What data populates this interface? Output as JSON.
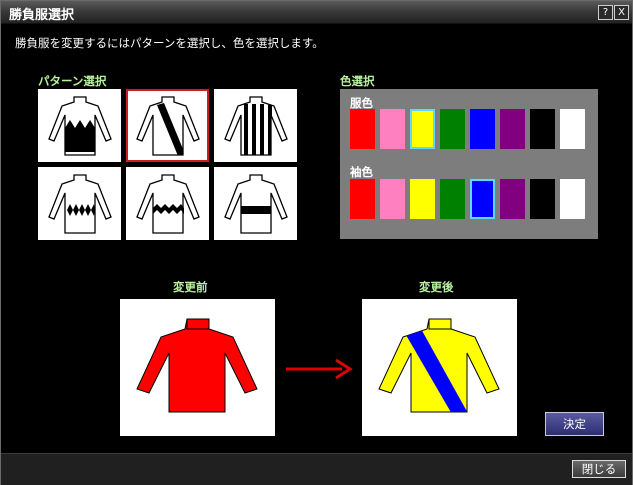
{
  "window": {
    "title": "勝負服選択"
  },
  "description": "勝負服を変更するにはパターンを選択し、色を選択します。",
  "pattern_section": {
    "title": "パターン選択",
    "selected_index": 1,
    "patterns": [
      "bottom-jagged",
      "diagonal-sash",
      "vertical-stripes",
      "diamonds-band",
      "zigzag-band",
      "horizontal-band"
    ]
  },
  "color_section": {
    "title": "色選択",
    "body_label": "服色",
    "sleeve_label": "袖色",
    "body_colors": [
      "#ff0000",
      "#ff80c0",
      "#ffff00",
      "#008000",
      "#0000ff",
      "#800080",
      "#000000",
      "#ffffff"
    ],
    "sleeve_colors": [
      "#ff0000",
      "#ff80c0",
      "#ffff00",
      "#008000",
      "#0000ff",
      "#800080",
      "#000000",
      "#ffffff"
    ],
    "body_selected": 2,
    "sleeve_selected": 4
  },
  "preview": {
    "before_label": "変更前",
    "after_label": "変更後",
    "before_body_color": "#ff0000",
    "before_sleeve_color": "#ff0000",
    "after_body_color": "#ffff00",
    "after_sleeve_color": "#ffff00",
    "after_sash_color": "#0000ff"
  },
  "buttons": {
    "ok": "決定",
    "close": "閉じる",
    "help": "?",
    "close_x": "X"
  },
  "arrow_color": "#e00000"
}
